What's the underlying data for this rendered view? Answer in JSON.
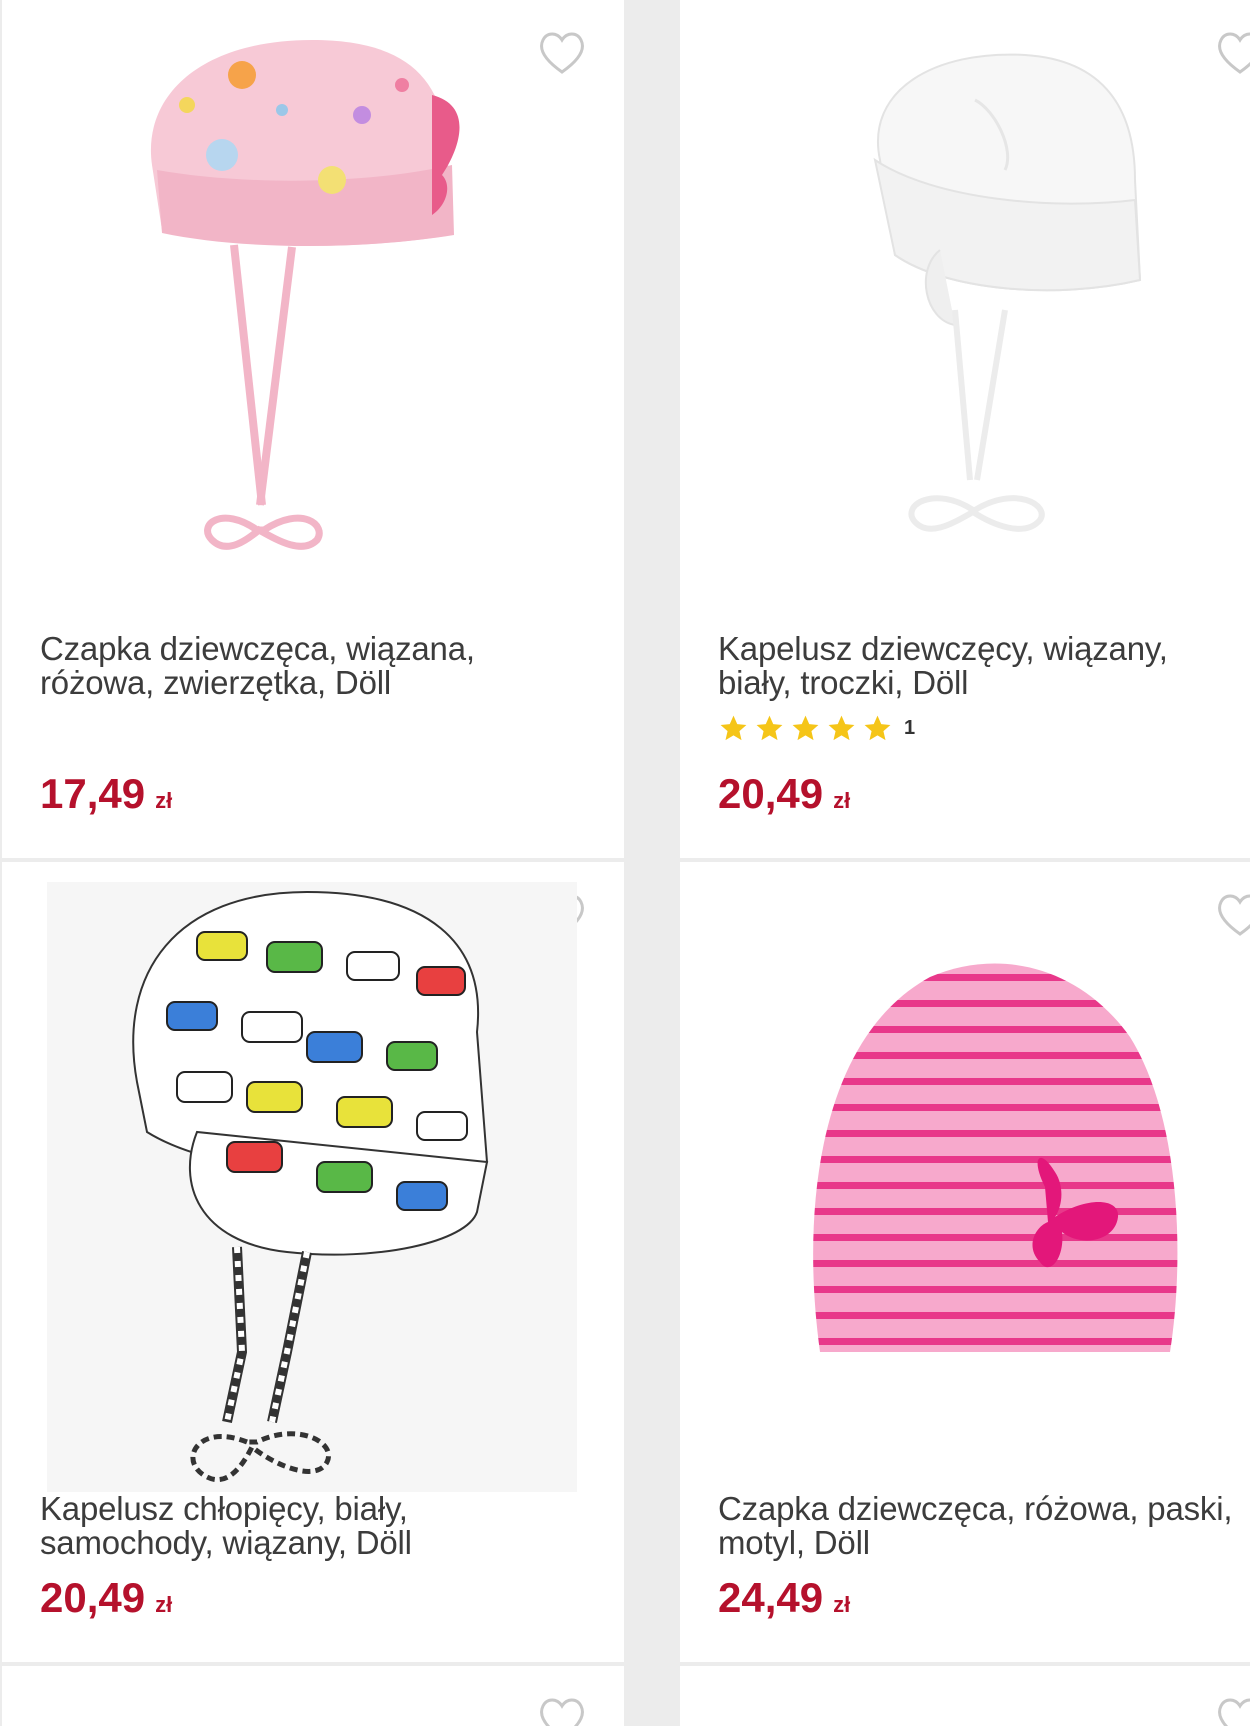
{
  "colors": {
    "price": "#b5112c",
    "star": "#f5c518",
    "heart": "#c8c8c8"
  },
  "products": [
    {
      "title": "Czapka dziewczęca, wiązana,\nróżowa, zwierzętka, Döll",
      "price": "17,49",
      "currency": "zł",
      "image_icon": "pink-bandana-hat-image"
    },
    {
      "title": "Kapelusz dziewczęcy, wiązany,\nbiały, troczki, Döll",
      "price": "20,49",
      "currency": "zł",
      "rating_stars": 5,
      "rating_count": "1",
      "image_icon": "white-hat-image"
    },
    {
      "title": "Kapelusz chłopięcy, biały,\nsamochody, wiązany, Döll",
      "price": "20,49",
      "currency": "zł",
      "image_icon": "cars-print-hat-image"
    },
    {
      "title": "Czapka dziewczęca, różowa, paski,\nmotyl, Döll",
      "price": "24,49",
      "currency": "zł",
      "image_icon": "pink-striped-beanie-image"
    }
  ]
}
